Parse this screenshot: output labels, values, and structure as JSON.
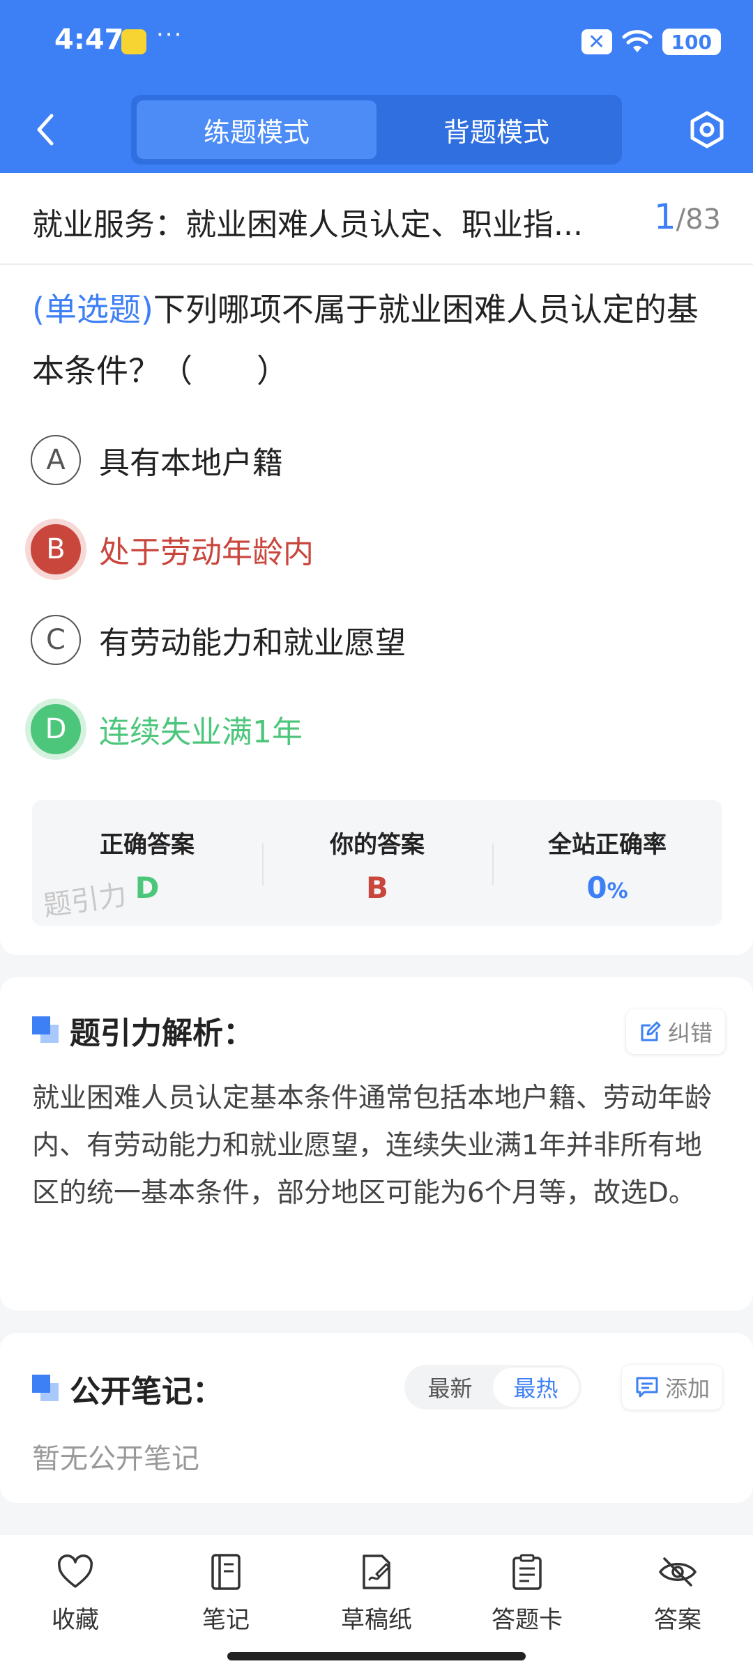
{
  "status_bar": {
    "time": "4:47",
    "dots": "···",
    "close_glyph": "✕",
    "battery": "100"
  },
  "nav": {
    "tabs": [
      {
        "label": "练题模式",
        "active": true
      },
      {
        "label": "背题模式",
        "active": false
      }
    ]
  },
  "question": {
    "title": "就业服务：就业困难人员认定、职业指...",
    "current": "1",
    "total": "/83",
    "type_tag": "(单选题)",
    "text": "下列哪项不属于就业困难人员认定的基本条件？（　　）",
    "options": [
      {
        "letter": "A",
        "text": "具有本地户籍",
        "state": "normal"
      },
      {
        "letter": "B",
        "text": "处于劳动年龄内",
        "state": "wrong"
      },
      {
        "letter": "C",
        "text": "有劳动能力和就业愿望",
        "state": "normal"
      },
      {
        "letter": "D",
        "text": "连续失业满1年",
        "state": "right"
      }
    ]
  },
  "answer_box": {
    "correct_label": "正确答案",
    "correct_value": "D",
    "yours_label": "你的答案",
    "yours_value": "B",
    "rate_label": "全站正确率",
    "rate_value": "0",
    "rate_unit": "%",
    "watermark": "题引力"
  },
  "analysis": {
    "title": "题引力解析：",
    "report_label": "纠错",
    "text": "就业困难人员认定基本条件通常包括本地户籍、劳动年龄内、有劳动能力和就业愿望，连续失业满1年并非所有地区的统一基本条件，部分地区可能为6个月等，故选D。"
  },
  "notes": {
    "title": "公开笔记：",
    "sort": [
      {
        "label": "最新",
        "active": false
      },
      {
        "label": "最热",
        "active": true
      }
    ],
    "add_label": "添加",
    "empty_text": "暂无公开笔记"
  },
  "bottom_bar": {
    "items": [
      {
        "label": "收藏",
        "icon": "heart-icon"
      },
      {
        "label": "笔记",
        "icon": "notebook-icon"
      },
      {
        "label": "草稿纸",
        "icon": "draft-icon"
      },
      {
        "label": "答题卡",
        "icon": "answer-card-icon"
      },
      {
        "label": "答案",
        "icon": "eye-off-icon"
      }
    ]
  },
  "colors": {
    "primary": "#3d7ff5",
    "wrong": "#c9463d",
    "right": "#4cc67a"
  }
}
